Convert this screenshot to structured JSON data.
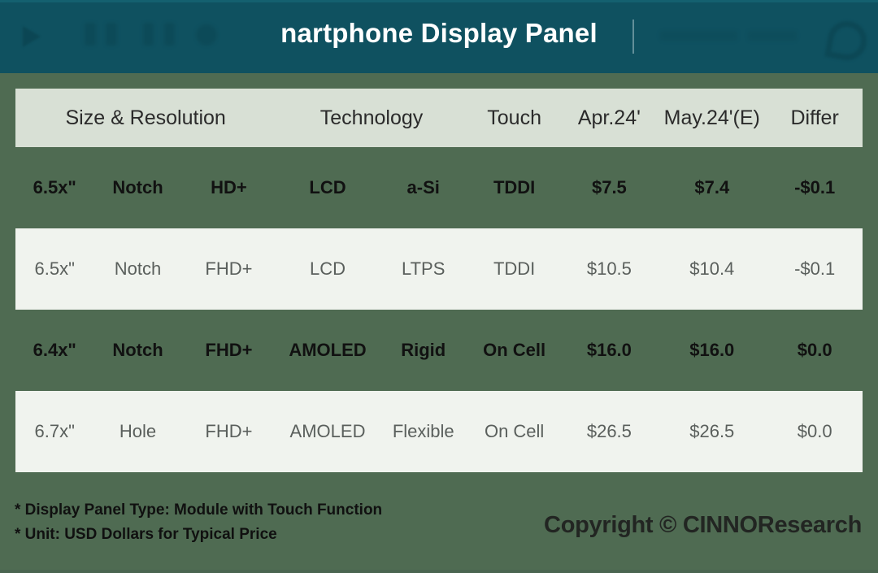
{
  "header": {
    "title": "nartphone Display Panel",
    "full_title_visible": "nartphone Display Panel",
    "background_color": "#0f5160",
    "title_color": "#ffffff",
    "icons": [
      "play-triangle-ghost-icon",
      "phone-ghost-icon",
      "device-ghost-icon"
    ]
  },
  "page": {
    "background_color": "#4f6b52"
  },
  "table": {
    "header_background": "#d8e0d5",
    "columns": [
      {
        "key": "size_resolution",
        "label": "Size & Resolution"
      },
      {
        "key": "technology",
        "label": "Technology"
      },
      {
        "key": "touch",
        "label": "Touch"
      },
      {
        "key": "apr",
        "label": "Apr.24'"
      },
      {
        "key": "may",
        "label": "May.24'(E)"
      },
      {
        "key": "differ",
        "label": "Differ"
      }
    ],
    "rows": [
      {
        "style": "bold",
        "size": "6.5x\"",
        "notch": "Notch",
        "resolution": "HD+",
        "technology": "LCD",
        "backplane": "a-Si",
        "touch": "TDDI",
        "apr": "$7.5",
        "may": "$7.4",
        "differ": "-$0.1"
      },
      {
        "style": "light",
        "size": "6.5x\"",
        "notch": "Notch",
        "resolution": "FHD+",
        "technology": "LCD",
        "backplane": "LTPS",
        "touch": "TDDI",
        "apr": "$10.5",
        "may": "$10.4",
        "differ": "-$0.1"
      },
      {
        "style": "bold",
        "size": "6.4x\"",
        "notch": "Notch",
        "resolution": "FHD+",
        "technology": "AMOLED",
        "backplane": "Rigid",
        "touch": "On Cell",
        "apr": "$16.0",
        "may": "$16.0",
        "differ": "$0.0"
      },
      {
        "style": "light",
        "size": "6.7x\"",
        "notch": "Hole",
        "resolution": "FHD+",
        "technology": "AMOLED",
        "backplane": "Flexible",
        "touch": "On Cell",
        "apr": "$26.5",
        "may": "$26.5",
        "differ": "$0.0"
      }
    ]
  },
  "footer": {
    "note_1": "* Display Panel Type:  Module with Touch Function",
    "note_2": "* Unit:  USD Dollars for Typical Price",
    "watermark": "Copyright © CINNOResearch"
  }
}
